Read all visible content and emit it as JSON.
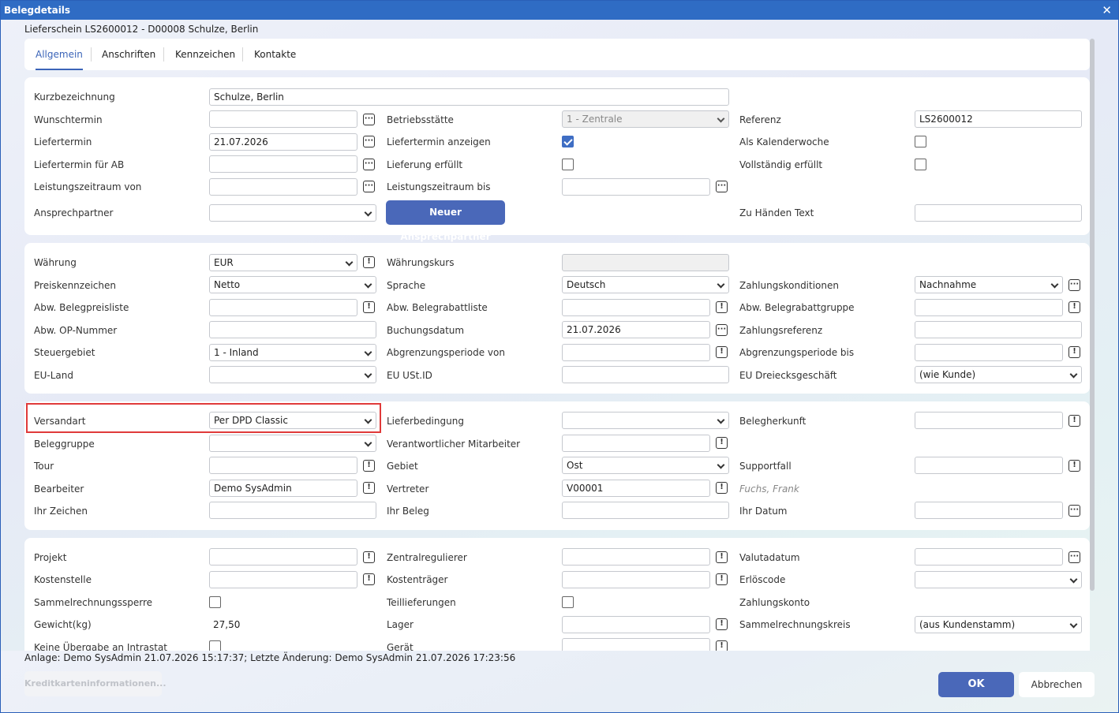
{
  "window": {
    "title": "Belegdetails",
    "close": "✕"
  },
  "subtitle": "Lieferschein LS2600012 - D00008 Schulze, Berlin",
  "tabs": [
    "Allgemein",
    "Anschriften",
    "Kennzeichen",
    "Kontakte"
  ],
  "icons": {
    "calendar": "···",
    "info": "!"
  },
  "section1": {
    "kurzbezeichnung": {
      "label": "Kurzbezeichnung",
      "value": "Schulze, Berlin"
    },
    "wunschtermin": {
      "label": "Wunschtermin",
      "value": ""
    },
    "betriebsstaette": {
      "label": "Betriebsstätte",
      "value": "1 - Zentrale"
    },
    "referenz": {
      "label": "Referenz",
      "value": "LS2600012"
    },
    "liefertermin": {
      "label": "Liefertermin",
      "value": "21.07.2026"
    },
    "liefertermin_anzeigen": {
      "label": "Liefertermin anzeigen",
      "checked": true
    },
    "als_kalenderwoche": {
      "label": "Als Kalenderwoche",
      "checked": false
    },
    "liefertermin_ab": {
      "label": "Liefertermin für AB",
      "value": ""
    },
    "lieferung_erfuellt": {
      "label": "Lieferung erfüllt",
      "checked": false
    },
    "vollstaendig_erfuellt": {
      "label": "Vollständig erfüllt",
      "checked": false
    },
    "leistungszeitraum_von": {
      "label": "Leistungszeitraum von",
      "value": ""
    },
    "leistungszeitraum_bis": {
      "label": "Leistungszeitraum bis",
      "value": ""
    },
    "ansprechpartner": {
      "label": "Ansprechpartner",
      "value": ""
    },
    "neuer_ansprechpartner": "Neuer Ansprechpartner",
    "zu_haenden": {
      "label": "Zu Händen Text",
      "value": ""
    }
  },
  "section2": {
    "waehrung": {
      "label": "Währung",
      "value": "EUR"
    },
    "waehrungskurs": {
      "label": "Währungskurs",
      "value": ""
    },
    "preiskennzeichen": {
      "label": "Preiskennzeichen",
      "value": "Netto"
    },
    "sprache": {
      "label": "Sprache",
      "value": "Deutsch"
    },
    "zahlungskonditionen": {
      "label": "Zahlungskonditionen",
      "value": "Nachnahme"
    },
    "abw_belegpreisliste": {
      "label": "Abw. Belegpreisliste",
      "value": ""
    },
    "abw_belegrabattliste": {
      "label": "Abw. Belegrabattliste",
      "value": ""
    },
    "abw_belegrabattgruppe": {
      "label": "Abw. Belegrabattgruppe",
      "value": ""
    },
    "abw_op_nummer": {
      "label": "Abw. OP-Nummer",
      "value": ""
    },
    "buchungsdatum": {
      "label": "Buchungsdatum",
      "value": "21.07.2026"
    },
    "zahlungsreferenz": {
      "label": "Zahlungsreferenz",
      "value": ""
    },
    "steuergebiet": {
      "label": "Steuergebiet",
      "value": "1 - Inland"
    },
    "abgrenzung_von": {
      "label": "Abgrenzungsperiode von",
      "value": ""
    },
    "abgrenzung_bis": {
      "label": "Abgrenzungsperiode bis",
      "value": ""
    },
    "eu_land": {
      "label": "EU-Land",
      "value": ""
    },
    "eu_ustid": {
      "label": "EU USt.ID",
      "value": ""
    },
    "eu_dreieck": {
      "label": "EU Dreiecksgeschäft",
      "value": "(wie Kunde)"
    }
  },
  "section3": {
    "versandart": {
      "label": "Versandart",
      "value": "Per DPD Classic"
    },
    "lieferbedingung": {
      "label": "Lieferbedingung",
      "value": ""
    },
    "belegherkunft": {
      "label": "Belegherkunft",
      "value": ""
    },
    "beleggruppe": {
      "label": "Beleggruppe",
      "value": ""
    },
    "verantwortlicher": {
      "label": "Verantwortlicher Mitarbeiter",
      "value": ""
    },
    "tour": {
      "label": "Tour",
      "value": ""
    },
    "gebiet": {
      "label": "Gebiet",
      "value": "Ost"
    },
    "supportfall": {
      "label": "Supportfall",
      "value": ""
    },
    "bearbeiter": {
      "label": "Bearbeiter",
      "value": "Demo SysAdmin"
    },
    "vertreter": {
      "label": "Vertreter",
      "value": "V00001"
    },
    "vertreter_name": "Fuchs, Frank",
    "ihr_zeichen": {
      "label": "Ihr Zeichen",
      "value": ""
    },
    "ihr_beleg": {
      "label": "Ihr Beleg",
      "value": ""
    },
    "ihr_datum": {
      "label": "Ihr Datum",
      "value": ""
    }
  },
  "section4": {
    "projekt": {
      "label": "Projekt",
      "value": ""
    },
    "zentralregulierer": {
      "label": "Zentralregulierer",
      "value": ""
    },
    "valutadatum": {
      "label": "Valutadatum",
      "value": ""
    },
    "kostenstelle": {
      "label": "Kostenstelle",
      "value": ""
    },
    "kostentraeger": {
      "label": "Kostenträger",
      "value": ""
    },
    "erloescode": {
      "label": "Erlöscode",
      "value": ""
    },
    "sammelrechnungssperre": {
      "label": "Sammelrechnungssperre",
      "checked": false
    },
    "teillieferungen": {
      "label": "Teillieferungen",
      "checked": false
    },
    "zahlungskonto": {
      "label": "Zahlungskonto"
    },
    "gewicht": {
      "label": "Gewicht(kg)",
      "value": "27,50"
    },
    "lager": {
      "label": "Lager",
      "value": ""
    },
    "sammelrechnungskreis": {
      "label": "Sammelrechnungskreis",
      "value": "(aus Kundenstamm)"
    },
    "keine_uebergabe": {
      "label": "Keine Übergabe an Intrastat",
      "checked": false
    },
    "geraet": {
      "label": "Gerät",
      "value": ""
    }
  },
  "footer": {
    "info": "Anlage: Demo SysAdmin 21.07.2026 15:17:37; Letzte Änderung: Demo SysAdmin 21.07.2026 17:23:56",
    "kreditkarten": "Kreditkarteninformationen...",
    "ok": "OK",
    "abbrechen": "Abbrechen"
  }
}
